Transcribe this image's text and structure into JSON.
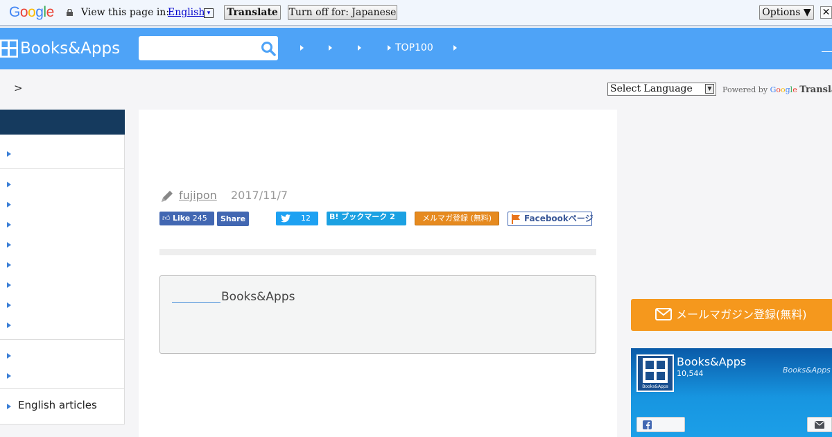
{
  "translate_bar": {
    "google": "Google",
    "view_text": "View this page in:",
    "language": "English",
    "dropdown_glyph": "▾",
    "translate_button": "Translate",
    "turn_off_button": "Turn off for: Japanese",
    "options_button": "Options ▼",
    "close_glyph": "✕"
  },
  "header": {
    "logo_text": "Books&Apps",
    "search": {
      "value": "",
      "placeholder": ""
    },
    "nav": [
      "",
      "",
      "",
      "TOP100",
      ""
    ]
  },
  "breadcrumb": ">",
  "language_select": {
    "selected": "Select Language",
    "powered_by": "Powered by",
    "google": "Google",
    "translate": "Translate"
  },
  "sidebar": {
    "items": [
      "",
      "",
      "",
      "",
      "",
      "",
      "",
      "",
      "",
      "",
      "",
      "English articles"
    ]
  },
  "article": {
    "author": "fujipon",
    "date": "2017/11/7",
    "share": {
      "fb_like": "Like",
      "fb_like_count": "245",
      "fb_share": "Share",
      "tweet_count": "12",
      "hatena_label": "B! ブックマーク",
      "hatena_count": "2",
      "mailmag": "メルマガ登録 (無料)",
      "fb_page": "Facebookページ"
    },
    "box_text": "Books&Apps"
  },
  "right": {
    "mail_button": "メールマガジン登録(無料)",
    "fb_widget": {
      "name": "Books&Apps",
      "count": "10,544",
      "watermark": "Books&Apps",
      "logo_text": "Books&Apps"
    }
  },
  "colors": {
    "header": "#4ea3f7",
    "sidebar_head": "#153a5e",
    "mail_orange": "#f5981d",
    "facebook": "#4267b2",
    "twitter": "#1da1f2"
  },
  "icons": [
    "google-logo",
    "lock-icon",
    "search-icon",
    "pencil-icon",
    "thumbs-up-icon",
    "twitter-icon",
    "flag-icon",
    "mail-icon",
    "facebook-icon",
    "message-icon"
  ]
}
